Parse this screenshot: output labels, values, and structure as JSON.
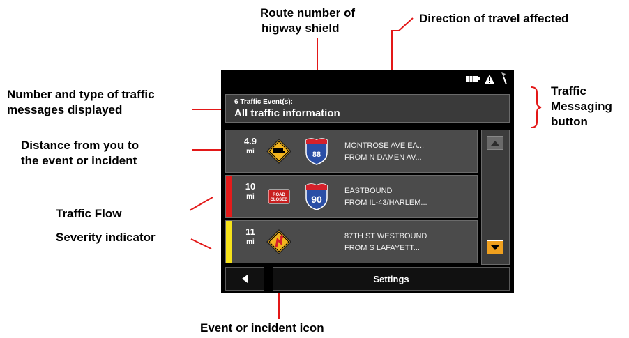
{
  "annotations": {
    "route_number": [
      "Route number of",
      "higway shield"
    ],
    "direction": "Direction of travel affected",
    "number_type": [
      "Number and type of traffic",
      "messages displayed"
    ],
    "traffic_messaging": [
      "Traffic",
      "Messaging",
      "button"
    ],
    "distance": [
      "Distance from you to",
      "the event or incident"
    ],
    "flow_severity": [
      "Traffic Flow",
      "Severity indicator"
    ],
    "event_icon": "Event or incident icon"
  },
  "device": {
    "traffic_button": {
      "count": "6 Traffic Event(s):",
      "title": "All traffic information"
    },
    "events": [
      {
        "distance": "4.9",
        "unit": "mi",
        "icon": "traffic-merge-sign-icon",
        "route": "88",
        "line1": "MONTROSE AVE EA...",
        "line2": "FROM N DAMEN AV...",
        "severity_color": ""
      },
      {
        "distance": "10",
        "unit": "mi",
        "icon": "road-closed-sign-icon",
        "icon_text": [
          "ROAD",
          "CLOSED"
        ],
        "route": "90",
        "line1": "EASTBOUND",
        "line2": "FROM IL-43/HARLEM...",
        "severity_color": "#e41b1b"
      },
      {
        "distance": "11",
        "unit": "mi",
        "icon": "incident-warning-sign-icon",
        "line1": "87TH ST WESTBOUND",
        "line2": "FROM S LAFAYETT...",
        "severity_color": "#f5e21a"
      }
    ],
    "settings_label": "Settings",
    "colors": {
      "accent_orange": "#f0a01e",
      "shield_blue": "#2a4ea6",
      "shield_red": "#d5202a"
    }
  }
}
